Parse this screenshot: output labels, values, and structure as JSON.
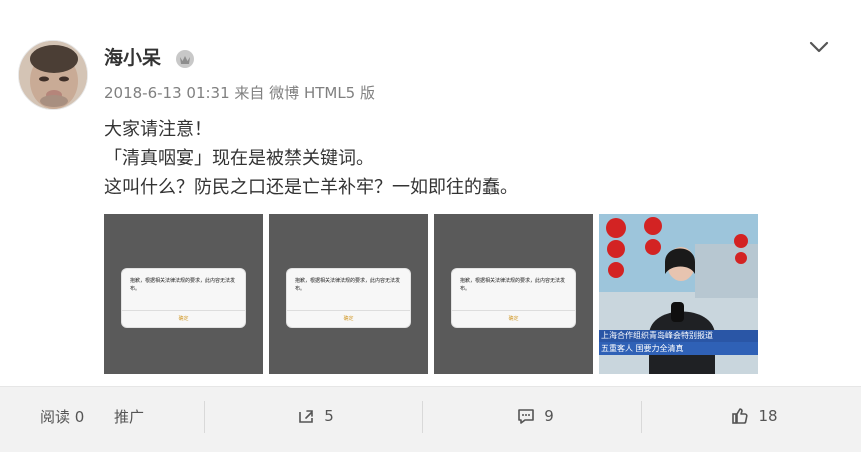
{
  "author": {
    "name": "海小呆"
  },
  "meta": {
    "datetime": "2018-6-13 01:31",
    "source": "来自 微博 HTML5 版"
  },
  "content": {
    "lines": [
      "大家请注意！",
      "「清真咽宴」现在是被禁关键词。",
      "这叫什么？防民之口还是亡羊补牢？一如即往的蠢。"
    ]
  },
  "images": {
    "dialog_text": "抱歉，根据相关法律法规的要求，此内容无法发布。",
    "dialog_button": "确定",
    "news_caption_1": "上海合作组织青岛峰会特别报道",
    "news_caption_2": "五重客人 国要力全清真"
  },
  "actions": {
    "read": "阅读 0",
    "promote": "推广",
    "share": "5",
    "comment": "9",
    "like": "18"
  },
  "colors": {
    "text": "#333333",
    "meta": "#808080",
    "background": "#f2f2f2",
    "dialog_button": "#d29b2c"
  }
}
